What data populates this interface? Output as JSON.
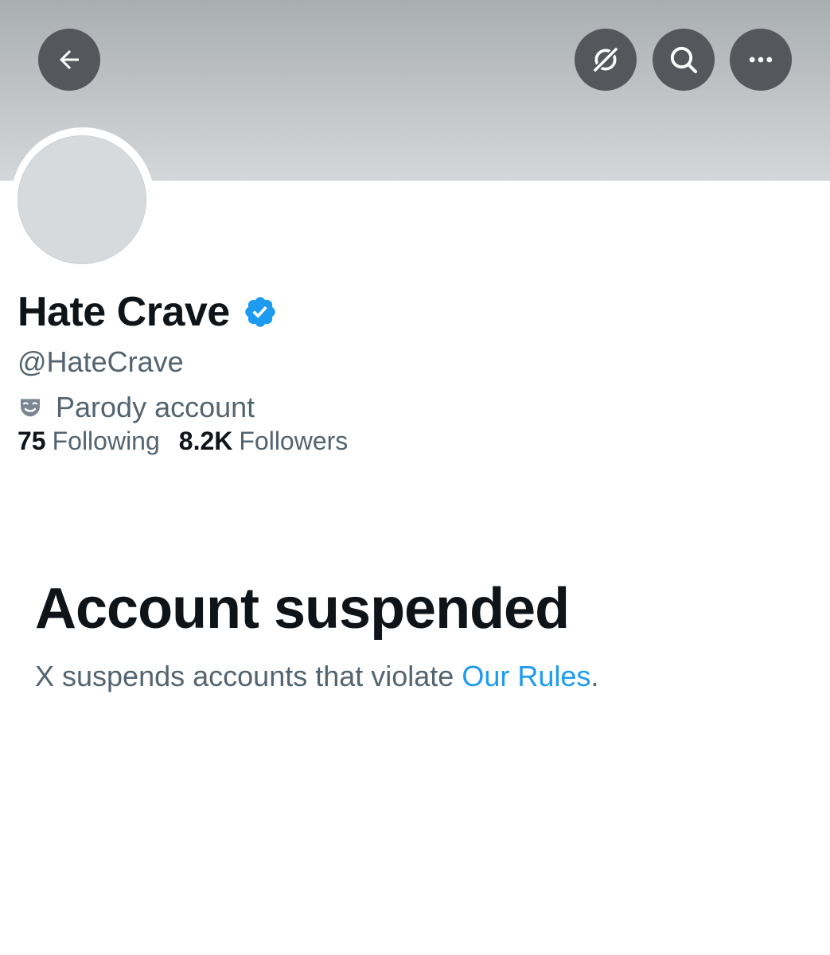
{
  "header": {
    "back_icon": "arrow-left-icon",
    "grok_icon": "grok-icon",
    "search_icon": "search-icon",
    "more_icon": "more-horizontal-icon"
  },
  "profile": {
    "display_name": "Hate Crave",
    "handle": "@HateCrave",
    "verified": true,
    "verified_color": "#1d9bf0",
    "label": "Parody account",
    "label_icon": "parody-mask-icon",
    "stats": {
      "following_count": "75",
      "following_label": "Following",
      "followers_count": "8.2K",
      "followers_label": "Followers"
    }
  },
  "suspension": {
    "title": "Account suspended",
    "description_prefix": "X suspends accounts that violate ",
    "link_text": "Our Rules",
    "description_suffix": "."
  }
}
